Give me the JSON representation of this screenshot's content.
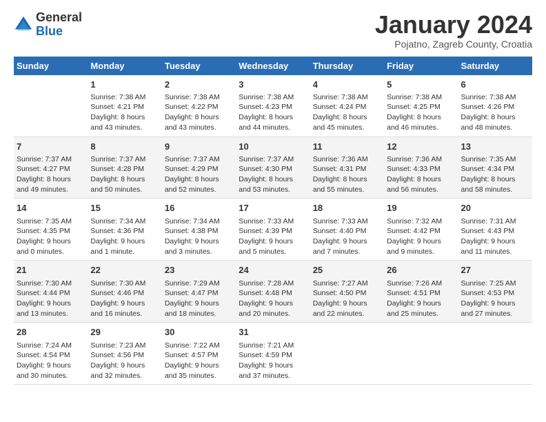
{
  "header": {
    "logo": {
      "general": "General",
      "blue": "Blue"
    },
    "month_title": "January 2024",
    "subtitle": "Pojatno, Zagreb County, Croatia"
  },
  "weekdays": [
    "Sunday",
    "Monday",
    "Tuesday",
    "Wednesday",
    "Thursday",
    "Friday",
    "Saturday"
  ],
  "weeks": [
    [
      {
        "day": "",
        "info": ""
      },
      {
        "day": "1",
        "info": "Sunrise: 7:38 AM\nSunset: 4:21 PM\nDaylight: 8 hours\nand 43 minutes."
      },
      {
        "day": "2",
        "info": "Sunrise: 7:38 AM\nSunset: 4:22 PM\nDaylight: 8 hours\nand 43 minutes."
      },
      {
        "day": "3",
        "info": "Sunrise: 7:38 AM\nSunset: 4:23 PM\nDaylight: 8 hours\nand 44 minutes."
      },
      {
        "day": "4",
        "info": "Sunrise: 7:38 AM\nSunset: 4:24 PM\nDaylight: 8 hours\nand 45 minutes."
      },
      {
        "day": "5",
        "info": "Sunrise: 7:38 AM\nSunset: 4:25 PM\nDaylight: 8 hours\nand 46 minutes."
      },
      {
        "day": "6",
        "info": "Sunrise: 7:38 AM\nSunset: 4:26 PM\nDaylight: 8 hours\nand 48 minutes."
      }
    ],
    [
      {
        "day": "7",
        "info": "Sunrise: 7:37 AM\nSunset: 4:27 PM\nDaylight: 8 hours\nand 49 minutes."
      },
      {
        "day": "8",
        "info": "Sunrise: 7:37 AM\nSunset: 4:28 PM\nDaylight: 8 hours\nand 50 minutes."
      },
      {
        "day": "9",
        "info": "Sunrise: 7:37 AM\nSunset: 4:29 PM\nDaylight: 8 hours\nand 52 minutes."
      },
      {
        "day": "10",
        "info": "Sunrise: 7:37 AM\nSunset: 4:30 PM\nDaylight: 8 hours\nand 53 minutes."
      },
      {
        "day": "11",
        "info": "Sunrise: 7:36 AM\nSunset: 4:31 PM\nDaylight: 8 hours\nand 55 minutes."
      },
      {
        "day": "12",
        "info": "Sunrise: 7:36 AM\nSunset: 4:33 PM\nDaylight: 8 hours\nand 56 minutes."
      },
      {
        "day": "13",
        "info": "Sunrise: 7:35 AM\nSunset: 4:34 PM\nDaylight: 8 hours\nand 58 minutes."
      }
    ],
    [
      {
        "day": "14",
        "info": "Sunrise: 7:35 AM\nSunset: 4:35 PM\nDaylight: 9 hours\nand 0 minutes."
      },
      {
        "day": "15",
        "info": "Sunrise: 7:34 AM\nSunset: 4:36 PM\nDaylight: 9 hours\nand 1 minute."
      },
      {
        "day": "16",
        "info": "Sunrise: 7:34 AM\nSunset: 4:38 PM\nDaylight: 9 hours\nand 3 minutes."
      },
      {
        "day": "17",
        "info": "Sunrise: 7:33 AM\nSunset: 4:39 PM\nDaylight: 9 hours\nand 5 minutes."
      },
      {
        "day": "18",
        "info": "Sunrise: 7:33 AM\nSunset: 4:40 PM\nDaylight: 9 hours\nand 7 minutes."
      },
      {
        "day": "19",
        "info": "Sunrise: 7:32 AM\nSunset: 4:42 PM\nDaylight: 9 hours\nand 9 minutes."
      },
      {
        "day": "20",
        "info": "Sunrise: 7:31 AM\nSunset: 4:43 PM\nDaylight: 9 hours\nand 11 minutes."
      }
    ],
    [
      {
        "day": "21",
        "info": "Sunrise: 7:30 AM\nSunset: 4:44 PM\nDaylight: 9 hours\nand 13 minutes."
      },
      {
        "day": "22",
        "info": "Sunrise: 7:30 AM\nSunset: 4:46 PM\nDaylight: 9 hours\nand 16 minutes."
      },
      {
        "day": "23",
        "info": "Sunrise: 7:29 AM\nSunset: 4:47 PM\nDaylight: 9 hours\nand 18 minutes."
      },
      {
        "day": "24",
        "info": "Sunrise: 7:28 AM\nSunset: 4:48 PM\nDaylight: 9 hours\nand 20 minutes."
      },
      {
        "day": "25",
        "info": "Sunrise: 7:27 AM\nSunset: 4:50 PM\nDaylight: 9 hours\nand 22 minutes."
      },
      {
        "day": "26",
        "info": "Sunrise: 7:26 AM\nSunset: 4:51 PM\nDaylight: 9 hours\nand 25 minutes."
      },
      {
        "day": "27",
        "info": "Sunrise: 7:25 AM\nSunset: 4:53 PM\nDaylight: 9 hours\nand 27 minutes."
      }
    ],
    [
      {
        "day": "28",
        "info": "Sunrise: 7:24 AM\nSunset: 4:54 PM\nDaylight: 9 hours\nand 30 minutes."
      },
      {
        "day": "29",
        "info": "Sunrise: 7:23 AM\nSunset: 4:56 PM\nDaylight: 9 hours\nand 32 minutes."
      },
      {
        "day": "30",
        "info": "Sunrise: 7:22 AM\nSunset: 4:57 PM\nDaylight: 9 hours\nand 35 minutes."
      },
      {
        "day": "31",
        "info": "Sunrise: 7:21 AM\nSunset: 4:59 PM\nDaylight: 9 hours\nand 37 minutes."
      },
      {
        "day": "",
        "info": ""
      },
      {
        "day": "",
        "info": ""
      },
      {
        "day": "",
        "info": ""
      }
    ]
  ]
}
